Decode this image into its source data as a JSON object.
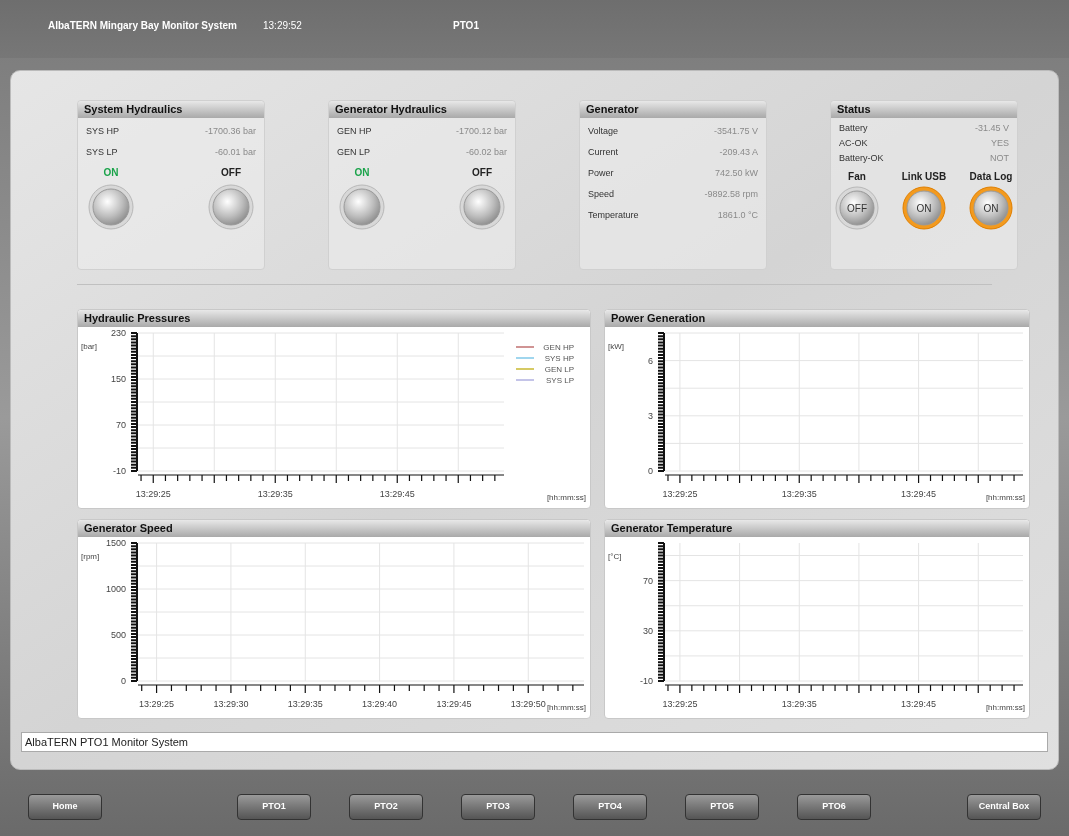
{
  "header": {
    "title": "AlbaTERN Mingary Bay Monitor System",
    "time": "13:29:52",
    "unit": "PTO1"
  },
  "panels": [
    {
      "kind": "readings",
      "title": "System Hydraulics",
      "readings": [
        {
          "label": "SYS HP",
          "value": "-1700.36 bar"
        },
        {
          "label": "SYS LP",
          "value": "-60.01 bar"
        }
      ],
      "switches": [
        {
          "label": "ON",
          "on": true
        },
        {
          "label": "OFF",
          "on": false
        }
      ]
    },
    {
      "kind": "readings",
      "title": "Generator Hydraulics",
      "readings": [
        {
          "label": "GEN HP",
          "value": "-1700.12 bar"
        },
        {
          "label": "GEN LP",
          "value": "-60.02 bar"
        }
      ],
      "switches": [
        {
          "label": "ON",
          "on": true
        },
        {
          "label": "OFF",
          "on": false
        }
      ]
    },
    {
      "kind": "readings",
      "title": "Generator",
      "readings": [
        {
          "label": "Voltage",
          "value": "-3541.75 V"
        },
        {
          "label": "Current",
          "value": "-209.43 A"
        },
        {
          "label": "Power",
          "value": "742.50 kW"
        },
        {
          "label": "Speed",
          "value": "-9892.58 rpm"
        },
        {
          "label": "Temperature",
          "value": "1861.0 °C"
        }
      ]
    },
    {
      "kind": "status",
      "title": "Status",
      "readings": [
        {
          "label": "Battery",
          "value": "-31.45 V"
        },
        {
          "label": "AC-OK",
          "value": "YES"
        },
        {
          "label": "Battery-OK",
          "value": "NOT"
        }
      ],
      "switches": [
        {
          "label": "Fan",
          "state": "OFF",
          "on": false
        },
        {
          "label": "Link USB",
          "state": "ON",
          "on": true
        },
        {
          "label": "Data Log",
          "state": "ON",
          "on": true
        }
      ]
    }
  ],
  "charts": [
    {
      "title": "Hydraulic Pressures",
      "chart_data": {
        "type": "line",
        "ylabel": "[bar]",
        "xlabel": "[hh:mm:ss]",
        "ylim": [
          -10,
          230
        ],
        "yticks": [
          -10,
          70,
          150,
          230
        ],
        "categories": [
          "13:29:25",
          null,
          "13:29:35",
          null,
          "13:29:45",
          null
        ],
        "grid": true,
        "series": [
          {
            "name": "GEN HP",
            "color": "#c07070",
            "values": [
              null,
              null,
              null,
              null,
              null,
              null
            ]
          },
          {
            "name": "SYS HP",
            "color": "#80c8e8",
            "values": [
              null,
              null,
              null,
              null,
              null,
              null
            ]
          },
          {
            "name": "GEN LP",
            "color": "#c8b830",
            "values": [
              null,
              null,
              null,
              null,
              null,
              null
            ]
          },
          {
            "name": "SYS LP",
            "color": "#b0b0e0",
            "values": [
              null,
              null,
              null,
              null,
              null,
              null
            ]
          }
        ]
      }
    },
    {
      "title": "Power Generation",
      "chart_data": {
        "type": "line",
        "ylabel": "[kW]",
        "xlabel": "[hh:mm:ss]",
        "ylim": [
          0,
          7.5
        ],
        "yticks": [
          0,
          3,
          6
        ],
        "grid": true,
        "categories": [
          "13:29:25",
          null,
          "13:29:35",
          null,
          "13:29:45",
          null
        ]
      }
    },
    {
      "title": "Generator Speed",
      "chart_data": {
        "type": "line",
        "ylabel": "[rpm]",
        "xlabel": "[hh:mm:ss]",
        "ylim": [
          0,
          1500
        ],
        "yticks": [
          0,
          500,
          1000,
          1500
        ],
        "grid": true,
        "categories": [
          "13:29:25",
          "13:29:30",
          "13:29:35",
          "13:29:40",
          "13:29:45",
          "13:29:50"
        ]
      }
    },
    {
      "title": "Generator Temperature",
      "chart_data": {
        "type": "line",
        "ylabel": "[°C]",
        "xlabel": "[hh:mm:ss]",
        "ylim": [
          -10,
          100
        ],
        "yticks": [
          -10,
          30,
          70
        ],
        "grid": true,
        "categories": [
          "13:29:25",
          null,
          "13:29:35",
          null,
          "13:29:45",
          null
        ]
      }
    }
  ],
  "status_line": "AlbaTERN PTO1 Monitor System",
  "nav": {
    "left": [
      "Home"
    ],
    "center": [
      "PTO1",
      "PTO2",
      "PTO3",
      "PTO4",
      "PTO5",
      "PTO6"
    ],
    "right": [
      "Central Box"
    ]
  }
}
